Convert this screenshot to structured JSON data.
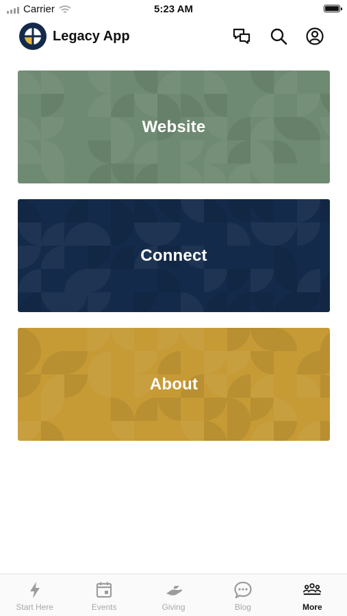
{
  "status_bar": {
    "carrier": "Carrier",
    "time": "5:23 AM"
  },
  "header": {
    "title": "Legacy App"
  },
  "tiles": [
    {
      "label": "Website",
      "color": "#6f8a72"
    },
    {
      "label": "Connect",
      "color": "#142a4a"
    },
    {
      "label": "About",
      "color": "#c69a35"
    }
  ],
  "tab_bar": {
    "tabs": [
      {
        "label": "Start Here",
        "icon": "bolt-icon",
        "active": false
      },
      {
        "label": "Events",
        "icon": "calendar-icon",
        "active": false
      },
      {
        "label": "Giving",
        "icon": "giving-hand-icon",
        "active": false
      },
      {
        "label": "Blog",
        "icon": "chat-bubble-icon",
        "active": false
      },
      {
        "label": "More",
        "icon": "people-icon",
        "active": true
      }
    ]
  }
}
